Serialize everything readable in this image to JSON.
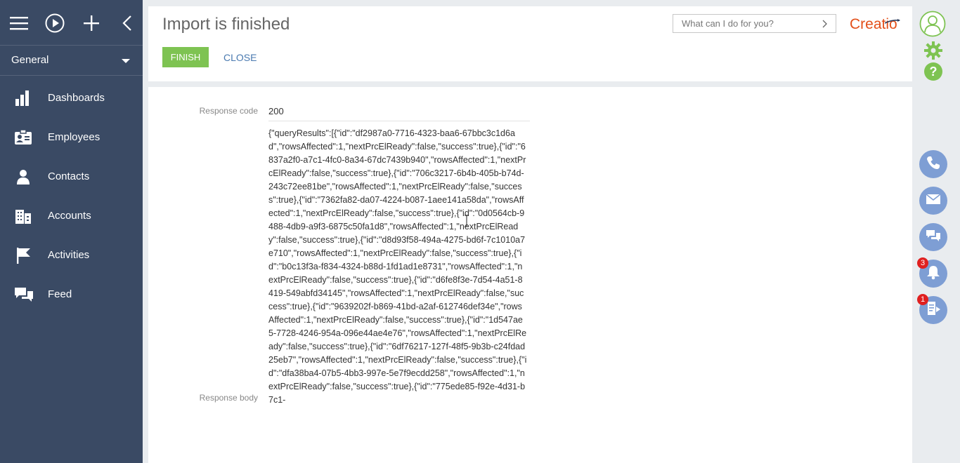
{
  "sidebar": {
    "workspace": "General",
    "items": [
      {
        "label": "Dashboards"
      },
      {
        "label": "Employees"
      },
      {
        "label": "Contacts"
      },
      {
        "label": "Accounts"
      },
      {
        "label": "Activities"
      },
      {
        "label": "Feed"
      }
    ]
  },
  "header": {
    "title": "Import is finished",
    "finish_label": "FINISH",
    "close_label": "CLOSE",
    "search_placeholder": "What can I do for you?",
    "logo_text": "Creatio"
  },
  "response": {
    "code_label": "Response code",
    "code_value": "200",
    "body_label": "Response body",
    "body_value": "{\"queryResults\":[{\"id\":\"df2987a0-7716-4323-baa6-67bbc3c1d6ad\",\"rowsAffected\":1,\"nextPrcElReady\":false,\"success\":true},{\"id\":\"6837a2f0-a7c1-4fc0-8a34-67dc7439b940\",\"rowsAffected\":1,\"nextPrcElReady\":false,\"success\":true},{\"id\":\"706c3217-6b4b-405b-b74d-243c72ee81be\",\"rowsAffected\":1,\"nextPrcElReady\":false,\"success\":true},{\"id\":\"7362fa82-da07-4224-b087-1aee141a58da\",\"rowsAffected\":1,\"nextPrcElReady\":false,\"success\":true},{\"id\":\"0d0564cb-9488-4db9-a9f3-6875c50fa1d8\",\"rowsAffected\":1,\"nextPrcElReady\":false,\"success\":true},{\"id\":\"d8d93f58-494a-4275-bd6f-7c1010a7e710\",\"rowsAffected\":1,\"nextPrcElReady\":false,\"success\":true},{\"id\":\"b0c13f3a-f834-4324-b88d-1fd1ad1e8731\",\"rowsAffected\":1,\"nextPrcElReady\":false,\"success\":true},{\"id\":\"d6fe8f3e-7d54-4a51-8419-549abfd34145\",\"rowsAffected\":1,\"nextPrcElReady\":false,\"success\":true},{\"id\":\"9639202f-b869-41bd-a2af-612746def34e\",\"rowsAffected\":1,\"nextPrcElReady\":false,\"success\":true},{\"id\":\"1d547ae5-7728-4246-954a-096e44ae4e76\",\"rowsAffected\":1,\"nextPrcElReady\":false,\"success\":true},{\"id\":\"6df76217-127f-48f5-9b3b-c24fdad25eb7\",\"rowsAffected\":1,\"nextPrcElReady\":false,\"success\":true},{\"id\":\"dfa38ba4-07b5-4bb3-997e-5e7f9ecdd258\",\"rowsAffected\":1,\"nextPrcElReady\":false,\"success\":true},{\"id\":\"775ede85-f92e-4d31-b7c1-"
  },
  "rightbar": {
    "notifications_count": "3",
    "process_count": "1"
  },
  "colors": {
    "sidebar_bg": "#3a4a64",
    "finish_green": "#7ec352",
    "link_blue": "#4a7ab0",
    "logo_orange": "#e3501a",
    "round_button_blue": "#7e9ed4",
    "badge_red": "#e02020",
    "settings_green": "#7ec352"
  }
}
